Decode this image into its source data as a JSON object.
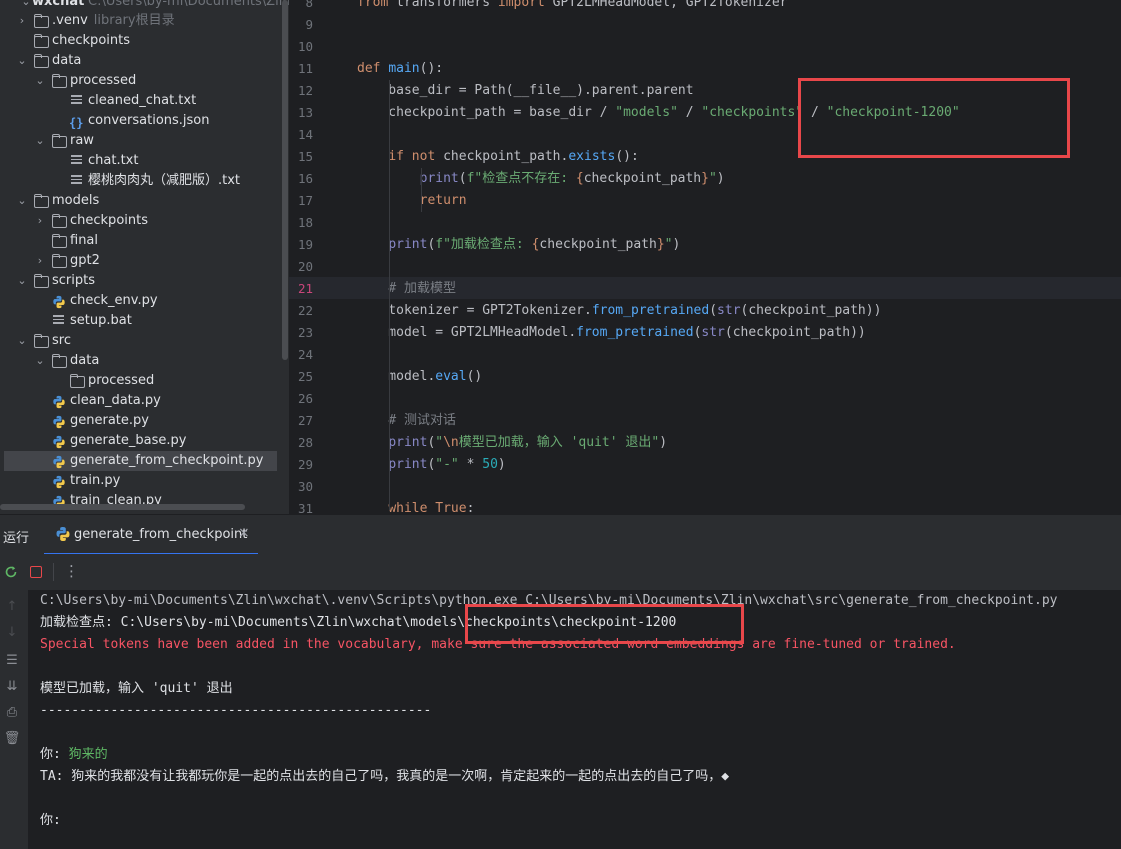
{
  "project": {
    "root_name": "wxchat",
    "root_path": "C:\\Users\\by-mi\\Documents\\Zlin\\wxc",
    "items": [
      {
        "label": ".venv",
        "hint": "library根目录",
        "type": "folder",
        "depth": 1,
        "expanded": false
      },
      {
        "label": "checkpoints",
        "type": "folder",
        "depth": 1,
        "expanded": null
      },
      {
        "label": "data",
        "type": "folder",
        "depth": 1,
        "expanded": true
      },
      {
        "label": "processed",
        "type": "folder",
        "depth": 2,
        "expanded": true
      },
      {
        "label": "cleaned_chat.txt",
        "type": "text",
        "depth": 3
      },
      {
        "label": "conversations.json",
        "type": "json",
        "depth": 3
      },
      {
        "label": "raw",
        "type": "folder",
        "depth": 2,
        "expanded": true
      },
      {
        "label": "chat.txt",
        "type": "text",
        "depth": 3
      },
      {
        "label": "樱桃肉肉丸（减肥版）.txt",
        "type": "text",
        "depth": 3
      },
      {
        "label": "models",
        "type": "folder",
        "depth": 1,
        "expanded": true
      },
      {
        "label": "checkpoints",
        "type": "folder",
        "depth": 2,
        "expanded": false
      },
      {
        "label": "final",
        "type": "folder",
        "depth": 2,
        "expanded": null
      },
      {
        "label": "gpt2",
        "type": "folder",
        "depth": 2,
        "expanded": false
      },
      {
        "label": "scripts",
        "type": "folder",
        "depth": 1,
        "expanded": true
      },
      {
        "label": "check_env.py",
        "type": "python",
        "depth": 2
      },
      {
        "label": "setup.bat",
        "type": "text",
        "depth": 2
      },
      {
        "label": "src",
        "type": "folder",
        "depth": 1,
        "expanded": true
      },
      {
        "label": "data",
        "type": "folder",
        "depth": 2,
        "expanded": true
      },
      {
        "label": "processed",
        "type": "folder",
        "depth": 3,
        "expanded": null
      },
      {
        "label": "clean_data.py",
        "type": "python",
        "depth": 2
      },
      {
        "label": "generate.py",
        "type": "python",
        "depth": 2
      },
      {
        "label": "generate_base.py",
        "type": "python",
        "depth": 2
      },
      {
        "label": "generate_from_checkpoint.py",
        "type": "python",
        "depth": 2,
        "selected": true
      },
      {
        "label": "train.py",
        "type": "python",
        "depth": 2
      },
      {
        "label": "train_clean.py",
        "type": "python",
        "depth": 2
      }
    ]
  },
  "editor": {
    "current_line": "21",
    "lines": [
      {
        "no": "8",
        "html": "<span class=\"k\">from</span> transformers <span class=\"k\">import</span> GPT2LMHeadModel, GPT2Tokenizer"
      },
      {
        "no": "9",
        "html": ""
      },
      {
        "no": "10",
        "html": ""
      },
      {
        "no": "11",
        "html": "<span class=\"k\">def</span> <span class=\"f\">main</span>():"
      },
      {
        "no": "12",
        "html": "    base_dir = Path(__file__).parent.parent"
      },
      {
        "no": "13",
        "html": "    checkpoint_path = base_dir / <span class=\"s\">\"models\"</span> / <span class=\"s\">\"checkpoints\"</span> / <span class=\"s\">\"checkpoint-1200\"</span>"
      },
      {
        "no": "14",
        "html": ""
      },
      {
        "no": "15",
        "html": "    <span class=\"k\">if not</span> checkpoint_path.<span class=\"f\">exists</span>():"
      },
      {
        "no": "16",
        "html": "        <span class=\"b\">print</span>(<span class=\"s\">f\"检查点不存在: </span><span class=\"e\">{</span>checkpoint_path<span class=\"e\">}</span><span class=\"s\">\"</span>)"
      },
      {
        "no": "17",
        "html": "        <span class=\"k\">return</span>"
      },
      {
        "no": "18",
        "html": ""
      },
      {
        "no": "19",
        "html": "    <span class=\"b\">print</span>(<span class=\"s\">f\"加载检查点: </span><span class=\"e\">{</span>checkpoint_path<span class=\"e\">}</span><span class=\"s\">\"</span>)"
      },
      {
        "no": "20",
        "html": ""
      },
      {
        "no": "21",
        "html": "    <span class=\"c\"># 加载模型</span>"
      },
      {
        "no": "22",
        "html": "    tokenizer = GPT2Tokenizer.<span class=\"f\">from_pretrained</span>(<span class=\"b\">str</span>(checkpoint_path))"
      },
      {
        "no": "23",
        "html": "    model = GPT2LMHeadModel.<span class=\"f\">from_pretrained</span>(<span class=\"b\">str</span>(checkpoint_path))"
      },
      {
        "no": "24",
        "html": ""
      },
      {
        "no": "25",
        "html": "    model.<span class=\"f\">eval</span>()"
      },
      {
        "no": "26",
        "html": ""
      },
      {
        "no": "27",
        "html": "    <span class=\"c\"># 测试对话</span>"
      },
      {
        "no": "28",
        "html": "    <span class=\"b\">print</span>(<span class=\"s\">\"</span><span class=\"e\">\\n</span><span class=\"s\">模型已加载，输入 'quit' 退出\"</span>)"
      },
      {
        "no": "29",
        "html": "    <span class=\"b\">print</span>(<span class=\"s\">\"-\"</span> * <span class=\"n\">50</span>)"
      },
      {
        "no": "30",
        "html": ""
      },
      {
        "no": "31",
        "html": "    <span class=\"k\">while True</span>:"
      }
    ]
  },
  "run": {
    "title": "运行",
    "tab_label": "generate_from_checkpoint",
    "close_glyph": "×",
    "more_glyph": "⋮"
  },
  "console": {
    "cmd": "C:\\Users\\by-mi\\Documents\\Zlin\\wxchat\\.venv\\Scripts\\python.exe C:\\Users\\by-mi\\Documents\\Zlin\\wxchat\\src\\generate_from_checkpoint.py",
    "loading": "加载检查点: C:\\Users\\by-mi\\Documents\\Zlin\\wxchat\\models\\checkpoints\\checkpoint-1200",
    "warning": "Special tokens have been added in the vocabulary, make sure the associated word embeddings are fine-tuned or trained.",
    "loaded": "模型已加载，输入 'quit' 退出",
    "separator": "--------------------------------------------------",
    "you_prefix": "你: ",
    "you_input": "狗来的",
    "ta_reply": "TA: 狗来的我都没有让我都玩你是一起的点出去的自己了吗，我真的是一次啊，肯定起来的一起的点出去的自己了吗，◆",
    "you_prompt": "你:"
  },
  "colors": {
    "highlight_box": "#e8474a",
    "error_text": "#f75464",
    "user_input": "#5fb865",
    "accent": "#3574f0"
  }
}
